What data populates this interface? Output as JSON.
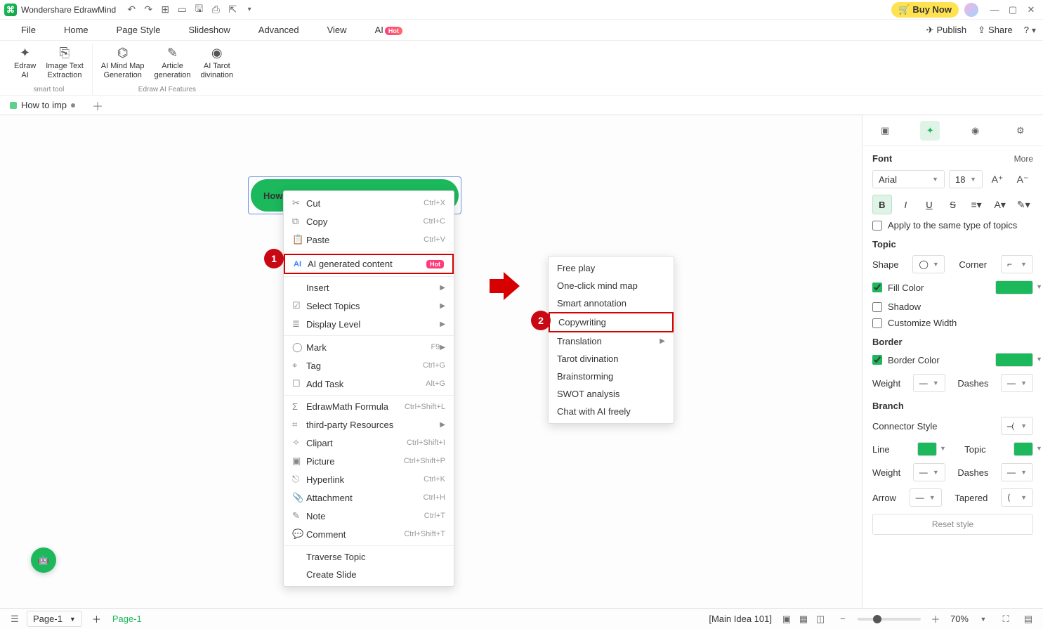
{
  "titlebar": {
    "app": "Wondershare EdrawMind",
    "buynow": "Buy Now"
  },
  "menubar": {
    "items": [
      "File",
      "Home",
      "Page Style",
      "Slideshow",
      "Advanced",
      "View",
      "AI"
    ],
    "hot": "Hot",
    "publish": "Publish",
    "share": "Share"
  },
  "ribbon": {
    "g1": {
      "b1": "Edraw\nAI",
      "b2": "Image Text\nExtraction",
      "label": "smart tool"
    },
    "g2": {
      "b1": "AI Mind Map\nGeneration",
      "b2": "Article\ngeneration",
      "b3": "AI Tarot\ndivination",
      "label": "Edraw AI Features"
    }
  },
  "doctab": {
    "name": "How to imp"
  },
  "node": {
    "text": "How"
  },
  "ctx1": [
    {
      "ico": "✂",
      "label": "Cut",
      "shortcut": "Ctrl+X"
    },
    {
      "ico": "⧉",
      "label": "Copy",
      "shortcut": "Ctrl+C"
    },
    {
      "ico": "📋",
      "label": "Paste",
      "shortcut": "Ctrl+V"
    },
    {
      "sep": true
    },
    {
      "ico": "AI",
      "label": "AI generated content",
      "hot": "Hot",
      "hl": true
    },
    {
      "sep": true
    },
    {
      "ico": "",
      "label": "Insert",
      "sub": true
    },
    {
      "ico": "☑",
      "label": "Select Topics",
      "sub": true
    },
    {
      "ico": "≣",
      "label": "Display Level",
      "sub": true
    },
    {
      "sep": true
    },
    {
      "ico": "◯",
      "label": "Mark",
      "shortcut": "F9",
      "sub": true
    },
    {
      "ico": "⌖",
      "label": "Tag",
      "shortcut": "Ctrl+G"
    },
    {
      "ico": "☐",
      "label": "Add Task",
      "shortcut": "Alt+G"
    },
    {
      "sep": true
    },
    {
      "ico": "Σ",
      "label": "EdrawMath Formula",
      "shortcut": "Ctrl+Shift+L"
    },
    {
      "ico": "⌗",
      "label": "third-party Resources",
      "sub": true
    },
    {
      "ico": "✧",
      "label": "Clipart",
      "shortcut": "Ctrl+Shift+I"
    },
    {
      "ico": "▣",
      "label": "Picture",
      "shortcut": "Ctrl+Shift+P"
    },
    {
      "ico": "⎋",
      "label": "Hyperlink",
      "shortcut": "Ctrl+K"
    },
    {
      "ico": "📎",
      "label": "Attachment",
      "shortcut": "Ctrl+H"
    },
    {
      "ico": "✎",
      "label": "Note",
      "shortcut": "Ctrl+T"
    },
    {
      "ico": "💬",
      "label": "Comment",
      "shortcut": "Ctrl+Shift+T"
    },
    {
      "sep": true
    },
    {
      "ico": "",
      "label": "Traverse Topic"
    },
    {
      "ico": "",
      "label": "Create Slide"
    }
  ],
  "ctx2": [
    {
      "label": "Free play"
    },
    {
      "label": "One-click mind map"
    },
    {
      "label": "Smart annotation"
    },
    {
      "label": "Copywriting",
      "hl": true
    },
    {
      "label": "Translation",
      "sub": true
    },
    {
      "label": "Tarot divination"
    },
    {
      "label": "Brainstorming"
    },
    {
      "label": "SWOT analysis"
    },
    {
      "label": "Chat with AI freely"
    }
  ],
  "badges": {
    "1": "1",
    "2": "2"
  },
  "rpanel": {
    "font": {
      "title": "Font",
      "more": "More",
      "family": "Arial",
      "size": "18",
      "apply": "Apply to the same type of topics"
    },
    "topic": {
      "title": "Topic",
      "shape": "Shape",
      "corner": "Corner",
      "fill": "Fill Color",
      "fillcolor": "#1cb85c",
      "shadow": "Shadow",
      "custw": "Customize Width"
    },
    "border": {
      "title": "Border",
      "color": "Border Color",
      "colorval": "#1cb85c",
      "weight": "Weight",
      "dashes": "Dashes"
    },
    "branch": {
      "title": "Branch",
      "conn": "Connector Style",
      "line": "Line",
      "linecol": "#1cb85c",
      "topic": "Topic",
      "topiccol": "#1cb85c",
      "weight": "Weight",
      "dashes": "Dashes",
      "arrow": "Arrow",
      "tapered": "Tapered"
    },
    "reset": "Reset style"
  },
  "status": {
    "page": "Page-1",
    "page2": "Page-1",
    "main": "[Main Idea 101]",
    "zoom": "70%"
  }
}
